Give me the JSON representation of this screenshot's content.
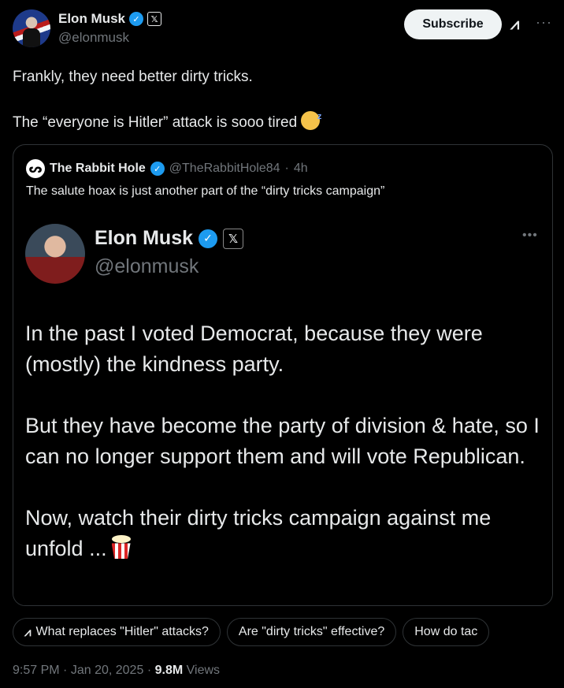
{
  "post": {
    "author_name": "Elon Musk",
    "author_handle": "@elonmusk",
    "subscribe_label": "Subscribe",
    "line1": "Frankly, they need better dirty tricks.",
    "line2": "The “everyone is Hitler” attack is sooo tired",
    "time": "9:57 PM",
    "date": "Jan 20, 2025",
    "views_count": "9.8M",
    "views_label": "Views"
  },
  "quote": {
    "name": "The Rabbit Hole",
    "handle": "@TheRabbitHole84",
    "age": "4h",
    "text": "The salute hoax is just another part of the “dirty tricks campaign”"
  },
  "quote_image": {
    "name": "Elon Musk",
    "handle": "@elonmusk",
    "para1": "In the past I voted Democrat, because they were (mostly) the kindness party.",
    "para2": "But they have become the party of division & hate, so I can no longer support them and will vote Republican.",
    "para3": "Now, watch their dirty tricks campaign against me unfold ..."
  },
  "chips": [
    "What replaces \"Hitler\" attacks?",
    "Are \"dirty tricks\" effective?",
    "How do tac"
  ],
  "colors": {
    "background": "#000000",
    "accent_blue": "#1d9bf0",
    "muted": "#71767b",
    "text": "#e7e9ea"
  },
  "icons": [
    "verified-badge-icon",
    "x-logo-icon",
    "grok-icon",
    "more-icon",
    "sleepy-emoji-icon",
    "popcorn-emoji-icon"
  ]
}
